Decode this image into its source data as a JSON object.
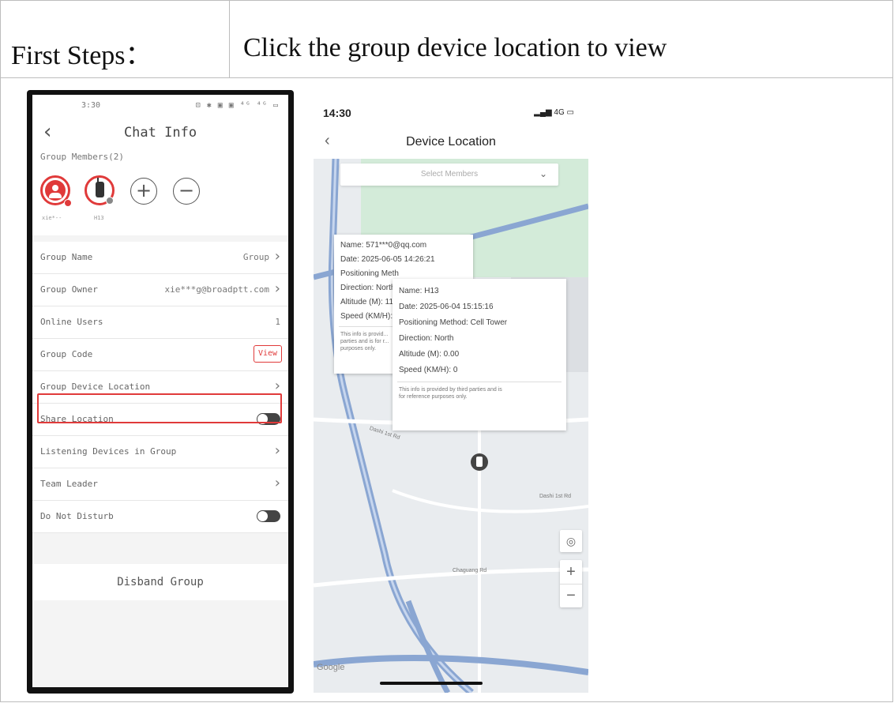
{
  "doc": {
    "step_label": "First Steps：",
    "step_text": "Click the group device location to view"
  },
  "left_phone": {
    "status_time": "3:30",
    "status_icons": "⊡ ✱ ▣ ▣ ⁴ᴳ ⁴ᴳ ▭",
    "title": "Chat Info",
    "group_members_label": "Group Members(2)",
    "members": [
      {
        "name": "xie*--",
        "icon": "user-icon"
      },
      {
        "name": "H13",
        "icon": "radio-device-icon"
      }
    ],
    "rows": [
      {
        "label": "Group Name",
        "value": "Group",
        "control": "chevron"
      },
      {
        "label": "Group Owner",
        "value": "xie***g@broadptt.com",
        "control": "chevron"
      },
      {
        "label": "Online Users",
        "value": "1",
        "control": "none"
      },
      {
        "label": "Group Code",
        "value": "View",
        "control": "button"
      },
      {
        "label": "Group Device Location",
        "value": "",
        "control": "chevron"
      },
      {
        "label": "Share Location",
        "value": "",
        "control": "toggle",
        "toggle_on": false
      },
      {
        "label": "Listening Devices in Group",
        "value": "",
        "control": "chevron"
      },
      {
        "label": "Team Leader",
        "value": "",
        "control": "chevron"
      },
      {
        "label": "Do Not Disturb",
        "value": "",
        "control": "toggle",
        "toggle_on": false
      }
    ],
    "disband": "Disband Group",
    "highlight_color": "#e03a3a"
  },
  "right_phone": {
    "status_time": "14:30",
    "status_signal": "4G",
    "title": "Device Location",
    "select_placeholder": "Select Members",
    "card1": {
      "name": "Name: 571***0@qq.com",
      "date": "Date: 2025-06-05 14:26:21",
      "method": "Positioning Meth",
      "direction": "Direction: North",
      "altitude": "Altitude (M): 11:",
      "speed": "Speed (KM/H): (",
      "note": "This info is provid... parties and is for r... purposes only."
    },
    "card2": {
      "name": "Name: H13",
      "date": "Date: 2025-06-04 15:15:16",
      "method": "Positioning Method: Cell Tower",
      "direction": "Direction: North",
      "altitude": "Altitude (M): 0.00",
      "speed": "Speed (KM/H): 0",
      "note": "This info is provided by third parties and is for reference purposes only."
    },
    "road_labels": [
      "Dashi 1st Rd",
      "Dashi 1st Rd",
      "Chaguang Rd"
    ],
    "map_attribution": "Google"
  }
}
